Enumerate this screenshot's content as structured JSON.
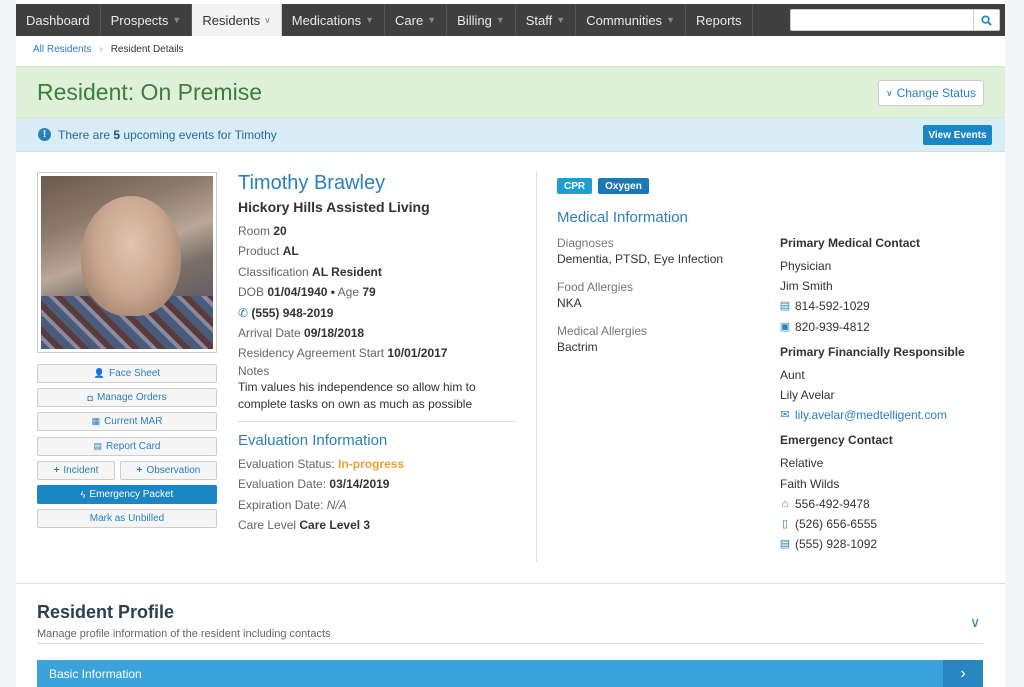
{
  "nav": {
    "items": [
      {
        "label": "Dashboard",
        "caret": false,
        "active": false
      },
      {
        "label": "Prospects",
        "caret": true,
        "active": false
      },
      {
        "label": "Residents",
        "caret": true,
        "active": true
      },
      {
        "label": "Medications",
        "caret": true,
        "active": false
      },
      {
        "label": "Care",
        "caret": true,
        "active": false
      },
      {
        "label": "Billing",
        "caret": true,
        "active": false
      },
      {
        "label": "Staff",
        "caret": true,
        "active": false
      },
      {
        "label": "Communities",
        "caret": true,
        "active": false
      },
      {
        "label": "Reports",
        "caret": false,
        "active": false
      }
    ],
    "search_value": ""
  },
  "breadcrumb": {
    "parent": "All Residents",
    "current": "Resident Details"
  },
  "header": {
    "title": "Resident: On Premise",
    "change_status": "Change Status"
  },
  "alert": {
    "prefix": "There are",
    "count": "5",
    "suffix": "upcoming events for Timothy",
    "button": "View Events"
  },
  "resident": {
    "name": "Timothy Brawley",
    "community": "Hickory Hills Assisted Living",
    "room_label": "Room",
    "room": "20",
    "product_label": "Product",
    "product": "AL",
    "classification_label": "Classification",
    "classification": "AL Resident",
    "dob_label": "DOB",
    "dob": "01/04/1940",
    "age_label": "Age",
    "age": "79",
    "phone": "(555) 948-2019",
    "arrival_label": "Arrival Date",
    "arrival": "09/18/2018",
    "agreement_label": "Residency Agreement Start",
    "agreement": "10/01/2017",
    "notes_label": "Notes",
    "notes": "Tim values his independence so allow him to complete tasks on own as much as possible"
  },
  "side_buttons": {
    "face_sheet": "Face Sheet",
    "manage_orders": "Manage Orders",
    "current_mar": "Current MAR",
    "report_card": "Report Card",
    "incident": "Incident",
    "observation": "Observation",
    "emergency_packet": "Emergency Packet",
    "mark_unbilled": "Mark as Unbilled"
  },
  "evaluation": {
    "title": "Evaluation Information",
    "status_label": "Evaluation Status:",
    "status": "In-progress",
    "date_label": "Evaluation Date:",
    "date": "03/14/2019",
    "expiration_label": "Expiration Date:",
    "expiration": "N/A",
    "care_label": "Care Level",
    "care": "Care Level 3"
  },
  "tags": [
    "CPR",
    "Oxygen"
  ],
  "medical": {
    "title": "Medical Information",
    "diagnoses_label": "Diagnoses",
    "diagnoses": "Dementia, PTSD, Eye Infection",
    "food_label": "Food Allergies",
    "food": "NKA",
    "med_label": "Medical Allergies",
    "med": "Bactrim"
  },
  "contacts": {
    "primary_medical": {
      "title": "Primary Medical Contact",
      "role": "Physician",
      "name": "Jim Smith",
      "phone": "814-592-1029",
      "fax": "820-939-4812"
    },
    "financial": {
      "title": "Primary Financially Responsible",
      "role": "Aunt",
      "name": "Lily Avelar",
      "email": "lily.avelar@medtelligent.com"
    },
    "emergency": {
      "title": "Emergency Contact",
      "role": "Relative",
      "name": "Faith Wilds",
      "home": "556-492-9478",
      "mobile": "(526) 656-6555",
      "office": "(555) 928-1092"
    }
  },
  "profile": {
    "title": "Resident Profile",
    "subtitle": "Manage profile information of the resident including contacts",
    "basic_info": "Basic Information"
  }
}
